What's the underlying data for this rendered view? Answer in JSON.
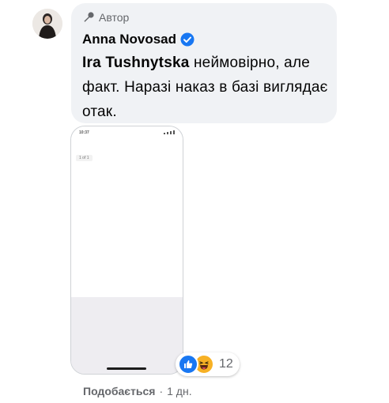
{
  "comment": {
    "badge_label": "Автор",
    "author_name": "Anna Novosad",
    "mention": "Ira Tushnytska",
    "text": " неймовірно, але факт. Наразі наказ в базі виглядає отак."
  },
  "attachment": {
    "phone_time": "10:37",
    "page_counter": "1 of 1"
  },
  "reactions": {
    "icons": [
      "like-icon",
      "haha-icon"
    ],
    "count": "12"
  },
  "actions": {
    "like_label": "Подобається",
    "separator": "·",
    "time_ago": "1 дн."
  },
  "colors": {
    "bubble_bg": "#f0f2f5",
    "secondary_text": "#65676b",
    "verified_blue": "#1877f2",
    "haha_yellow": "#f7b125"
  }
}
